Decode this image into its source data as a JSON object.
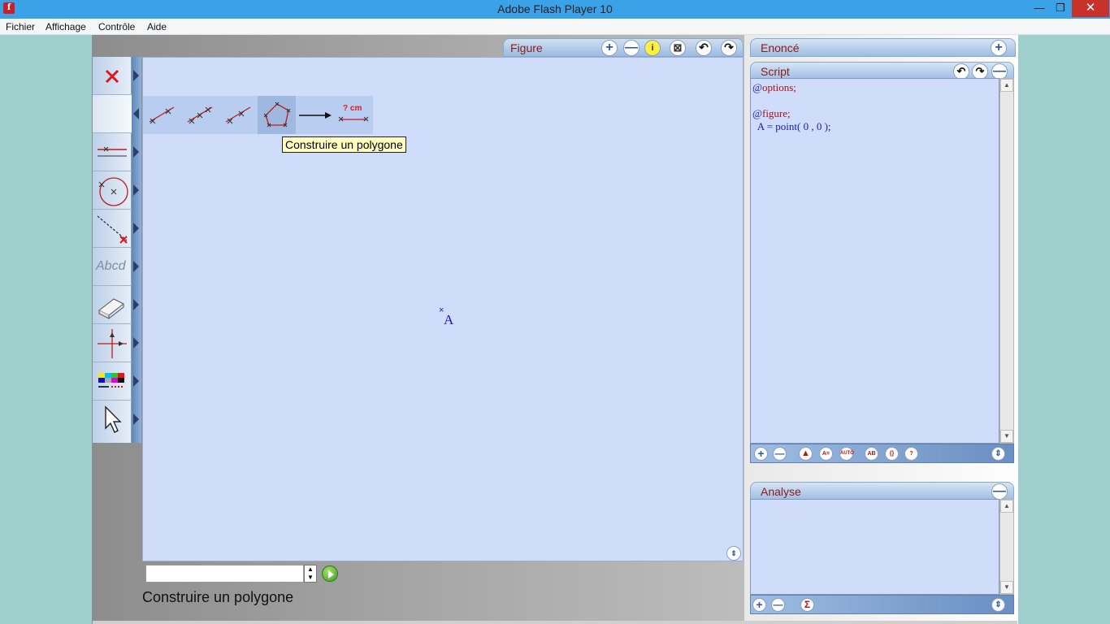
{
  "window": {
    "title": "Adobe Flash Player 10",
    "minimize": "—",
    "maximize": "❐",
    "close": "✕"
  },
  "menu": [
    "Fichier",
    "Affichage",
    "Contrôle",
    "Aide"
  ],
  "figure_panel": {
    "title": "Figure",
    "buttons": {
      "zoom_in": "+",
      "zoom_out": "—",
      "info": "i",
      "frame": "⊠",
      "undo": "↶",
      "redo": "↷"
    }
  },
  "subtoolbar": {
    "tooltip": "Construire un polygone",
    "measure_label": "? cm"
  },
  "canvas": {
    "point_mark": "×",
    "point_name": "A"
  },
  "bottom": {
    "input_value": "",
    "spin_up": "▲",
    "spin_down": "▼",
    "status": "Construire un polygone"
  },
  "toolbar": {
    "text_tool": "Abcd"
  },
  "enonce_panel": {
    "title": "Enoncé",
    "add": "+"
  },
  "script_panel": {
    "title": "Script",
    "lines": [
      {
        "prefix": "@",
        "text": "options;"
      },
      {
        "prefix": "",
        "text": ""
      },
      {
        "prefix": "@",
        "text": "figure;"
      },
      {
        "prefix": "",
        "text": "  A = point( 0 , 0 );"
      }
    ],
    "foot_buttons": [
      "+",
      "—",
      "▲",
      "A=",
      "AUTO",
      "AB",
      "{}",
      "?"
    ]
  },
  "analyse_panel": {
    "title": "Analyse",
    "collapse": "—",
    "foot_buttons": [
      "+",
      "—",
      "Σ"
    ]
  },
  "colors": {
    "titlebar": "#3ba2e8",
    "canvas": "#cfdcfa",
    "close": "#c7322b",
    "accent_red": "#a0141e",
    "point_blue": "#1a1ab4"
  }
}
